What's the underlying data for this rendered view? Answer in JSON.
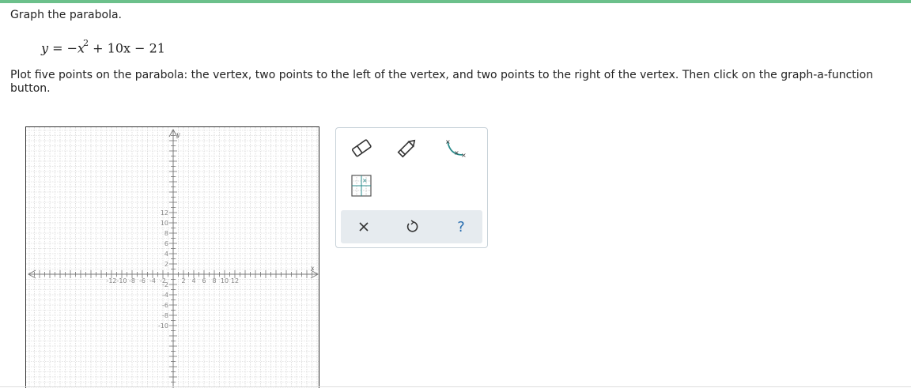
{
  "prompt": {
    "title": "Graph the parabola.",
    "equation": {
      "y": "y",
      "eq": "=",
      "neg": "−",
      "x": "x",
      "exp": "2",
      "rest": "+ 10x − 21"
    },
    "instructions": "Plot five points on the parabola: the vertex, two points to the left of the vertex, and two points to the right of the vertex. Then click on the graph-a-function button."
  },
  "graph": {
    "x_axis_label": "x",
    "y_axis_label": "y",
    "x_range": [
      -14,
      14
    ],
    "y_range": [
      -11,
      13
    ],
    "x_tick_labels": [
      "-12",
      "-10",
      "-8",
      "-6",
      "-4",
      "-2",
      "2",
      "4",
      "6",
      "8",
      "10",
      "12"
    ],
    "y_tick_labels": [
      "12",
      "10",
      "8",
      "6",
      "4",
      "2",
      "-2",
      "-4",
      "-6",
      "-8",
      "-10"
    ],
    "grid": true
  },
  "toolbar": {
    "tools": [
      "eraser-tool",
      "pencil-tool",
      "graph-a-function-tool",
      "point-table-tool"
    ],
    "actions": [
      "clear-all",
      "undo",
      "help"
    ],
    "help_label": "?",
    "clear_label": "✕",
    "undo_label": "↺",
    "accent": "#2a8c8c"
  }
}
